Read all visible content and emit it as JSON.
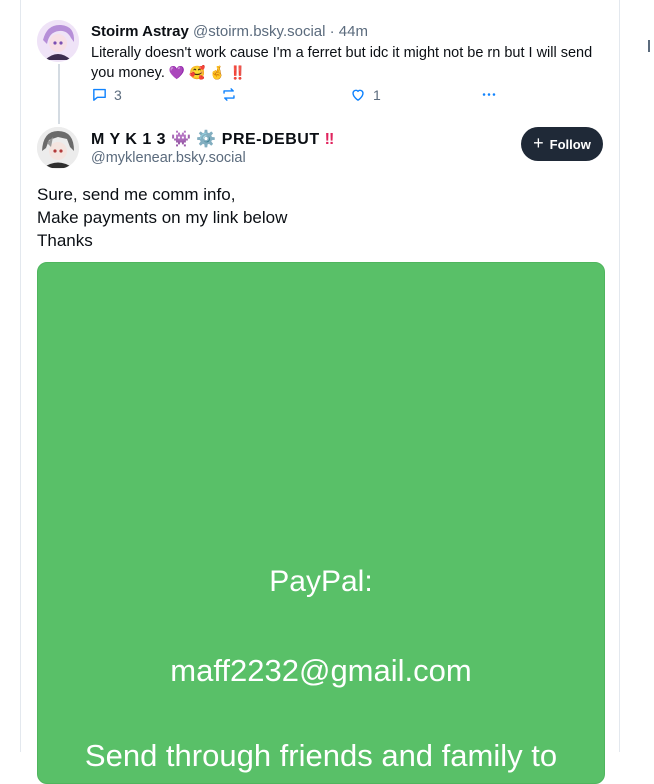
{
  "reply": {
    "display_name": "Stoirm Astray",
    "handle": "@stoirm.bsky.social",
    "time": "· 44m",
    "text": "Literally doesn't work cause I'm a ferret but idc it might not be rn but I will send you money.",
    "emojis": [
      "💜",
      "🥰",
      "🤞",
      "‼️"
    ],
    "reply_count": "3",
    "like_count": "1"
  },
  "post": {
    "display_name": "M Y K 1 3",
    "display_name_suffix": "PRE-DEBUT",
    "name_emojis": [
      "👾",
      "⚙️"
    ],
    "name_alert": "‼",
    "handle": "@myklenear.bsky.social",
    "follow_label": "Follow",
    "body_lines": [
      "Sure, send me comm info,",
      "Make payments on my link below",
      "Thanks"
    ],
    "image": {
      "label": "PayPal:",
      "email": "maff2232@gmail.com",
      "cut_text": "Send through friends and family to"
    }
  },
  "colors": {
    "accent_link": "#1083fe",
    "follow_bg": "#1f2937",
    "image_bg": "#59c068",
    "muted_text": "#5b6b7d"
  },
  "icons": [
    "reply-icon",
    "repost-icon",
    "like-icon",
    "more-icon",
    "plus-icon"
  ]
}
